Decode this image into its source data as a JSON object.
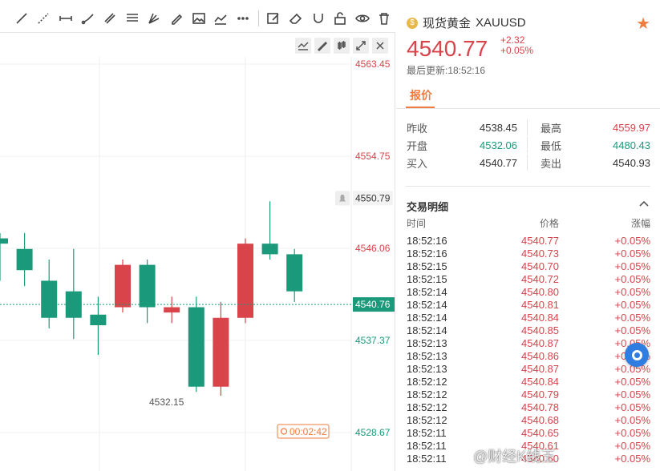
{
  "chart": {
    "y_labels": [
      "4563.45",
      "4554.75",
      "4546.06",
      "4537.37",
      "4528.67"
    ],
    "current_price_label": "4540.76",
    "alert_price_label": "4550.79",
    "low_label": "4532.15",
    "countdown": "00:02:42",
    "colors": {
      "up": "#d9434a",
      "down": "#1a9a7a"
    }
  },
  "chart_data": {
    "type": "candlestick",
    "ylim": [
      4525,
      4565
    ],
    "candles": [
      {
        "o": 4547.0,
        "c": 4546.5,
        "h": 4547.5,
        "l": 4543.0
      },
      {
        "o": 4546.0,
        "c": 4544.0,
        "h": 4547.5,
        "l": 4542.5
      },
      {
        "o": 4543.0,
        "c": 4539.5,
        "h": 4545.0,
        "l": 4538.5
      },
      {
        "o": 4542.0,
        "c": 4539.5,
        "h": 4546.0,
        "l": 4537.5
      },
      {
        "o": 4539.8,
        "c": 4538.8,
        "h": 4541.5,
        "l": 4536.0
      },
      {
        "o": 4540.5,
        "c": 4544.5,
        "h": 4545.0,
        "l": 4540.0
      },
      {
        "o": 4544.5,
        "c": 4540.5,
        "h": 4545.0,
        "l": 4539.0
      },
      {
        "o": 4540.0,
        "c": 4540.5,
        "h": 4541.5,
        "l": 4539.0
      },
      {
        "o": 4540.5,
        "c": 4533.0,
        "h": 4541.5,
        "l": 4532.5
      },
      {
        "o": 4533.0,
        "c": 4539.5,
        "h": 4541.0,
        "l": 4532.15
      },
      {
        "o": 4539.5,
        "c": 4546.5,
        "h": 4547.0,
        "l": 4539.0
      },
      {
        "o": 4546.5,
        "c": 4545.5,
        "h": 4550.5,
        "l": 4545.0
      },
      {
        "o": 4545.5,
        "c": 4542.0,
        "h": 4546.0,
        "l": 4541.0
      }
    ]
  },
  "quote": {
    "name": "现货黄金",
    "symbol": "XAUUSD",
    "price": "4540.77",
    "change": "+2.32",
    "change_pct": "+0.05%",
    "updated": "最后更新:18:52:16",
    "tab": "报价",
    "stats": [
      {
        "l1": "昨收",
        "v1": "4538.45",
        "c1": "dark",
        "l2": "最高",
        "v2": "4559.97",
        "c2": "red"
      },
      {
        "l1": "开盘",
        "v1": "4532.06",
        "c1": "green",
        "l2": "最低",
        "v2": "4480.43",
        "c2": "green"
      },
      {
        "l1": "买入",
        "v1": "4540.77",
        "c1": "dark",
        "l2": "卖出",
        "v2": "4540.93",
        "c2": "dark"
      }
    ]
  },
  "trades": {
    "title": "交易明细",
    "headers": [
      "时间",
      "价格",
      "涨幅"
    ],
    "rows": [
      [
        "18:52:16",
        "4540.77",
        "+0.05%"
      ],
      [
        "18:52:16",
        "4540.73",
        "+0.05%"
      ],
      [
        "18:52:15",
        "4540.70",
        "+0.05%"
      ],
      [
        "18:52:15",
        "4540.72",
        "+0.05%"
      ],
      [
        "18:52:14",
        "4540.80",
        "+0.05%"
      ],
      [
        "18:52:14",
        "4540.81",
        "+0.05%"
      ],
      [
        "18:52:14",
        "4540.84",
        "+0.05%"
      ],
      [
        "18:52:14",
        "4540.85",
        "+0.05%"
      ],
      [
        "18:52:13",
        "4540.87",
        "+0.05%"
      ],
      [
        "18:52:13",
        "4540.86",
        "+0.05%"
      ],
      [
        "18:52:13",
        "4540.87",
        "+0.05%"
      ],
      [
        "18:52:12",
        "4540.84",
        "+0.05%"
      ],
      [
        "18:52:12",
        "4540.79",
        "+0.05%"
      ],
      [
        "18:52:12",
        "4540.78",
        "+0.05%"
      ],
      [
        "18:52:12",
        "4540.68",
        "+0.05%"
      ],
      [
        "18:52:11",
        "4540.65",
        "+0.05%"
      ],
      [
        "18:52:11",
        "4540.61",
        "+0.05%"
      ],
      [
        "18:52:11",
        "4540.60",
        "+0.05%"
      ]
    ]
  },
  "watermark": "@财经K线王"
}
